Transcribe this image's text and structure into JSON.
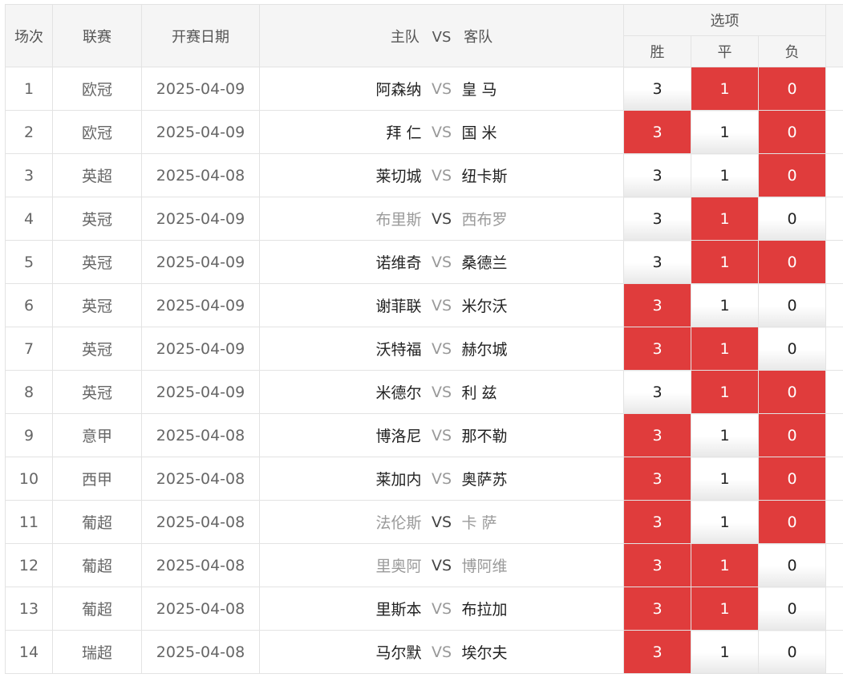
{
  "header": {
    "col_index": "场次",
    "col_league": "联赛",
    "col_date": "开赛日期",
    "col_home": "主队",
    "col_vs": "VS",
    "col_away": "客队",
    "col_options": "选项",
    "opt_win": "胜",
    "opt_draw": "平",
    "opt_lose": "负"
  },
  "colors": {
    "selected": "#e03c3c",
    "header_bg": "#f5f5f5"
  },
  "rows": [
    {
      "index": "1",
      "league": "欧冠",
      "date": "2025-04-09",
      "home": "阿森纳",
      "vs": "VS",
      "away": "皇 马",
      "win": "3",
      "draw": "1",
      "lose": "0",
      "win_selected": false,
      "draw_selected": true,
      "lose_selected": true,
      "dim": false
    },
    {
      "index": "2",
      "league": "欧冠",
      "date": "2025-04-09",
      "home": "拜 仁",
      "vs": "VS",
      "away": "国 米",
      "win": "3",
      "draw": "1",
      "lose": "0",
      "win_selected": true,
      "draw_selected": false,
      "lose_selected": true,
      "dim": false
    },
    {
      "index": "3",
      "league": "英超",
      "date": "2025-04-08",
      "home": "莱切城",
      "vs": "VS",
      "away": "纽卡斯",
      "win": "3",
      "draw": "1",
      "lose": "0",
      "win_selected": false,
      "draw_selected": false,
      "lose_selected": true,
      "dim": false
    },
    {
      "index": "4",
      "league": "英冠",
      "date": "2025-04-09",
      "home": "布里斯",
      "vs": "VS",
      "away": "西布罗",
      "win": "3",
      "draw": "1",
      "lose": "0",
      "win_selected": false,
      "draw_selected": true,
      "lose_selected": false,
      "dim": true
    },
    {
      "index": "5",
      "league": "英冠",
      "date": "2025-04-09",
      "home": "诺维奇",
      "vs": "VS",
      "away": "桑德兰",
      "win": "3",
      "draw": "1",
      "lose": "0",
      "win_selected": false,
      "draw_selected": true,
      "lose_selected": true,
      "dim": false
    },
    {
      "index": "6",
      "league": "英冠",
      "date": "2025-04-09",
      "home": "谢菲联",
      "vs": "VS",
      "away": "米尔沃",
      "win": "3",
      "draw": "1",
      "lose": "0",
      "win_selected": true,
      "draw_selected": false,
      "lose_selected": false,
      "dim": false
    },
    {
      "index": "7",
      "league": "英冠",
      "date": "2025-04-09",
      "home": "沃特福",
      "vs": "VS",
      "away": "赫尔城",
      "win": "3",
      "draw": "1",
      "lose": "0",
      "win_selected": true,
      "draw_selected": true,
      "lose_selected": false,
      "dim": false
    },
    {
      "index": "8",
      "league": "英冠",
      "date": "2025-04-09",
      "home": "米德尔",
      "vs": "VS",
      "away": "利 兹",
      "win": "3",
      "draw": "1",
      "lose": "0",
      "win_selected": false,
      "draw_selected": true,
      "lose_selected": true,
      "dim": false
    },
    {
      "index": "9",
      "league": "意甲",
      "date": "2025-04-08",
      "home": "博洛尼",
      "vs": "VS",
      "away": "那不勒",
      "win": "3",
      "draw": "1",
      "lose": "0",
      "win_selected": true,
      "draw_selected": false,
      "lose_selected": true,
      "dim": false
    },
    {
      "index": "10",
      "league": "西甲",
      "date": "2025-04-08",
      "home": "莱加内",
      "vs": "VS",
      "away": "奥萨苏",
      "win": "3",
      "draw": "1",
      "lose": "0",
      "win_selected": true,
      "draw_selected": false,
      "lose_selected": true,
      "dim": false
    },
    {
      "index": "11",
      "league": "葡超",
      "date": "2025-04-08",
      "home": "法伦斯",
      "vs": "VS",
      "away": "卡 萨",
      "win": "3",
      "draw": "1",
      "lose": "0",
      "win_selected": true,
      "draw_selected": false,
      "lose_selected": true,
      "dim": true
    },
    {
      "index": "12",
      "league": "葡超",
      "date": "2025-04-08",
      "home": "里奥阿",
      "vs": "VS",
      "away": "博阿维",
      "win": "3",
      "draw": "1",
      "lose": "0",
      "win_selected": true,
      "draw_selected": true,
      "lose_selected": false,
      "dim": true
    },
    {
      "index": "13",
      "league": "葡超",
      "date": "2025-04-08",
      "home": "里斯本",
      "vs": "VS",
      "away": "布拉加",
      "win": "3",
      "draw": "1",
      "lose": "0",
      "win_selected": true,
      "draw_selected": true,
      "lose_selected": false,
      "dim": false
    },
    {
      "index": "14",
      "league": "瑞超",
      "date": "2025-04-08",
      "home": "马尔默",
      "vs": "VS",
      "away": "埃尔夫",
      "win": "3",
      "draw": "1",
      "lose": "0",
      "win_selected": true,
      "draw_selected": false,
      "lose_selected": false,
      "dim": false
    }
  ]
}
